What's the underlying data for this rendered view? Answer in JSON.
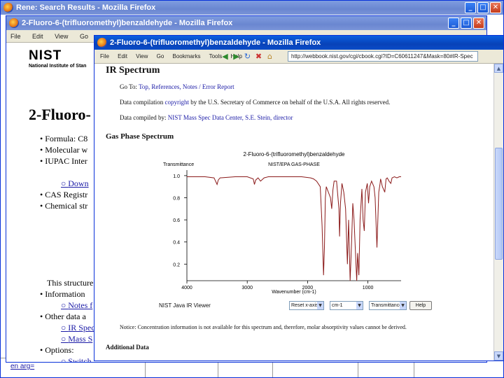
{
  "w1": {
    "title": "Rene: Search Results - Mozilla Firefox",
    "bottom_text": "en arg="
  },
  "w2": {
    "title": "2-Fluoro-6-(trifluoromethyl)benzaldehyde - Mozilla Firefox",
    "menu": [
      "File",
      "Edit",
      "View",
      "Go",
      "Bookmarks",
      "Tools",
      "Help"
    ],
    "nist_logo": "NIST",
    "nist_sub": "National Institute of Stan",
    "compound_title": "2-Fluoro-",
    "bullets": [
      {
        "text": "Formula: C8",
        "link": false
      },
      {
        "text": "Molecular w",
        "link": false
      },
      {
        "text": "IUPAC Inter",
        "link": false
      },
      {
        "text": "Down",
        "link": true
      },
      {
        "text": "CAS Registr",
        "link": false
      },
      {
        "text": "Chemical str",
        "link": false
      }
    ],
    "bullets2": [
      {
        "text": "This structure",
        "link": false
      },
      {
        "text": "Information",
        "link": false
      },
      {
        "text": "Notes f",
        "link": true
      },
      {
        "text": "Other data a",
        "link": false
      },
      {
        "text": "IR Spec",
        "link": true
      },
      {
        "text": "Mass S",
        "link": true
      },
      {
        "text": "Options:",
        "link": false
      },
      {
        "text": "Switch",
        "link": true
      }
    ]
  },
  "w3": {
    "title": "2-Fluoro-6-(trifluoromethyl)benzaldehyde - Mozilla Firefox",
    "menu": [
      "File",
      "Edit",
      "View",
      "Go",
      "Bookmarks",
      "Tools",
      "Help"
    ],
    "url": "http://webbook.nist.gov/cgi/cbook.cgi?ID=C60611247&Mask=80#IR-Spec",
    "heading": "IR Spectrum",
    "goto_label": "Go To:",
    "goto_links": "Top, References, Notes / Error Report",
    "copyright_pre": "Data compilation",
    "copyright_link": "copyright",
    "copyright_post": "by the U.S. Secretary of Commerce on behalf of the U.S.A. All rights reserved.",
    "compiled_pre": "Data compiled by:",
    "compiled_link": "NIST Mass Spec Data Center, S.E. Stein, director",
    "gas_phase": "Gas Phase Spectrum",
    "viewer_label": "NIST Java IR Viewer",
    "select1": "Reset x-axis",
    "select2": "cm-1",
    "select3": "Transmittance",
    "help": "Help",
    "notice": "Notice: Concentration information is not available for this spectrum and, therefore, molar absorptivity values cannot be derived.",
    "additional": "Additional Data"
  },
  "chart_data": {
    "type": "line",
    "title": "2-Fluoro-6-(trifluoromethyl)benzaldehyde",
    "subtitle": "NIST/EPA GAS-PHASE",
    "ylabel": "Transmittance",
    "xlabel": "Wavenumber (cm-1)",
    "xlim": [
      4000,
      450
    ],
    "ylim": [
      0.05,
      1.05
    ],
    "xticks": [
      4000,
      3000,
      2000,
      1000
    ],
    "yticks": [
      1.0,
      0.8,
      0.6,
      0.4,
      0.2
    ],
    "series": [
      {
        "color": "#8b1a1a",
        "x": [
          4000,
          3700,
          3550,
          3500,
          3480,
          3450,
          3200,
          3000,
          2900,
          2880,
          2860,
          2820,
          2780,
          2720,
          2650,
          2450,
          2100,
          1950,
          1900,
          1850,
          1790,
          1760,
          1735,
          1720,
          1705,
          1690,
          1620,
          1600,
          1580,
          1560,
          1520,
          1480,
          1470,
          1455,
          1430,
          1400,
          1370,
          1340,
          1320,
          1295,
          1270,
          1250,
          1230,
          1210,
          1185,
          1170,
          1150,
          1130,
          1100,
          1080,
          1060,
          1040,
          1010,
          990,
          970,
          940,
          900,
          880,
          850,
          820,
          800,
          790,
          760,
          720,
          700,
          680,
          650,
          620,
          600,
          560,
          520,
          480,
          450
        ],
        "y": [
          0.99,
          0.99,
          0.98,
          0.92,
          0.96,
          0.98,
          0.99,
          0.99,
          0.97,
          0.92,
          0.96,
          0.98,
          0.95,
          0.98,
          0.99,
          0.99,
          0.99,
          0.98,
          0.97,
          0.95,
          0.9,
          0.55,
          0.1,
          0.35,
          0.8,
          0.9,
          0.8,
          0.7,
          0.87,
          0.95,
          0.95,
          0.7,
          0.45,
          0.75,
          0.93,
          0.85,
          0.7,
          0.2,
          0.6,
          0.05,
          0.4,
          0.75,
          0.6,
          0.35,
          0.05,
          0.3,
          0.1,
          0.6,
          0.88,
          0.6,
          0.5,
          0.85,
          0.93,
          0.75,
          0.9,
          0.95,
          0.9,
          0.8,
          0.35,
          0.85,
          0.92,
          0.97,
          0.9,
          0.85,
          0.97,
          0.98,
          0.95,
          0.93,
          0.98,
          0.99,
          0.98,
          0.99,
          0.99
        ]
      }
    ]
  }
}
